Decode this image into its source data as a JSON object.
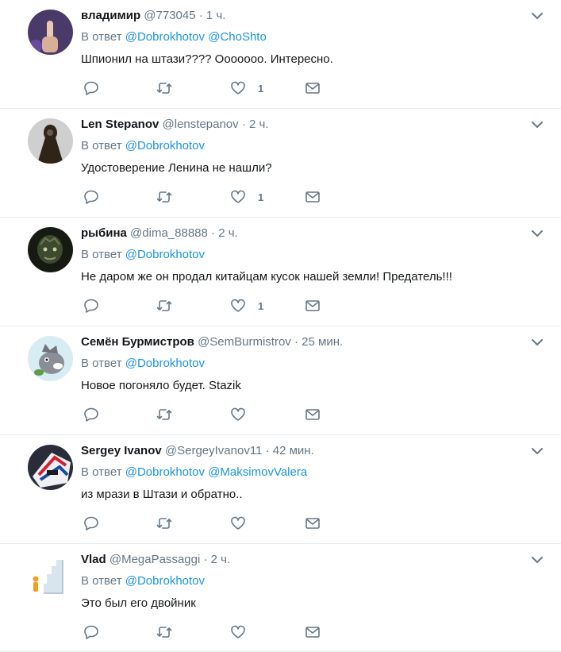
{
  "reply_prefix": "В ответ",
  "tweets": [
    {
      "name": "владимир",
      "handle": "@773045",
      "dot": "·",
      "time": "1 ч.",
      "mentions": [
        "@Dobrokhotov",
        "@ChoShto"
      ],
      "text": "Шпионил на штази????  Ооооооо. Интересно.",
      "likes": "1"
    },
    {
      "name": "Len Stepanov",
      "handle": "@lenstepanov",
      "dot": "·",
      "time": "2 ч.",
      "mentions": [
        "@Dobrokhotov"
      ],
      "text": "Удостоверение Ленина не нашли?",
      "likes": "1"
    },
    {
      "name": "рыбина",
      "handle": "@dima_88888",
      "dot": "·",
      "time": "2 ч.",
      "mentions": [
        "@Dobrokhotov"
      ],
      "text": "Не даром же он продал китайцам кусок нашей земли! Предатель!!!",
      "likes": "1"
    },
    {
      "name": "Семён Бурмистров",
      "handle": "@SemBurmistrov",
      "dot": "·",
      "time": "25 мин.",
      "mentions": [
        "@Dobrokhotov"
      ],
      "text": "Новое погоняло будет.  Stazik",
      "likes": ""
    },
    {
      "name": "Sergey Ivanov",
      "handle": "@SergeyIvanov11",
      "dot": "·",
      "time": "42 мин.",
      "mentions": [
        "@Dobrokhotov",
        "@MaksimovValera"
      ],
      "text": "из мрази в Штази и обратно..",
      "likes": ""
    },
    {
      "name": "Vlad",
      "handle": "@MegaPassaggi",
      "dot": "·",
      "time": "2 ч.",
      "mentions": [
        "@Dobrokhotov"
      ],
      "text": "Это был его двойник",
      "likes": ""
    }
  ],
  "icons": {
    "reply": "reply-icon",
    "retweet": "retweet-icon",
    "like": "heart-icon",
    "dm": "envelope-icon",
    "menu": "chevron-down-icon"
  },
  "colors": {
    "link": "#1b95e0",
    "secondary": "#657786",
    "divider": "#e6ecf0"
  }
}
